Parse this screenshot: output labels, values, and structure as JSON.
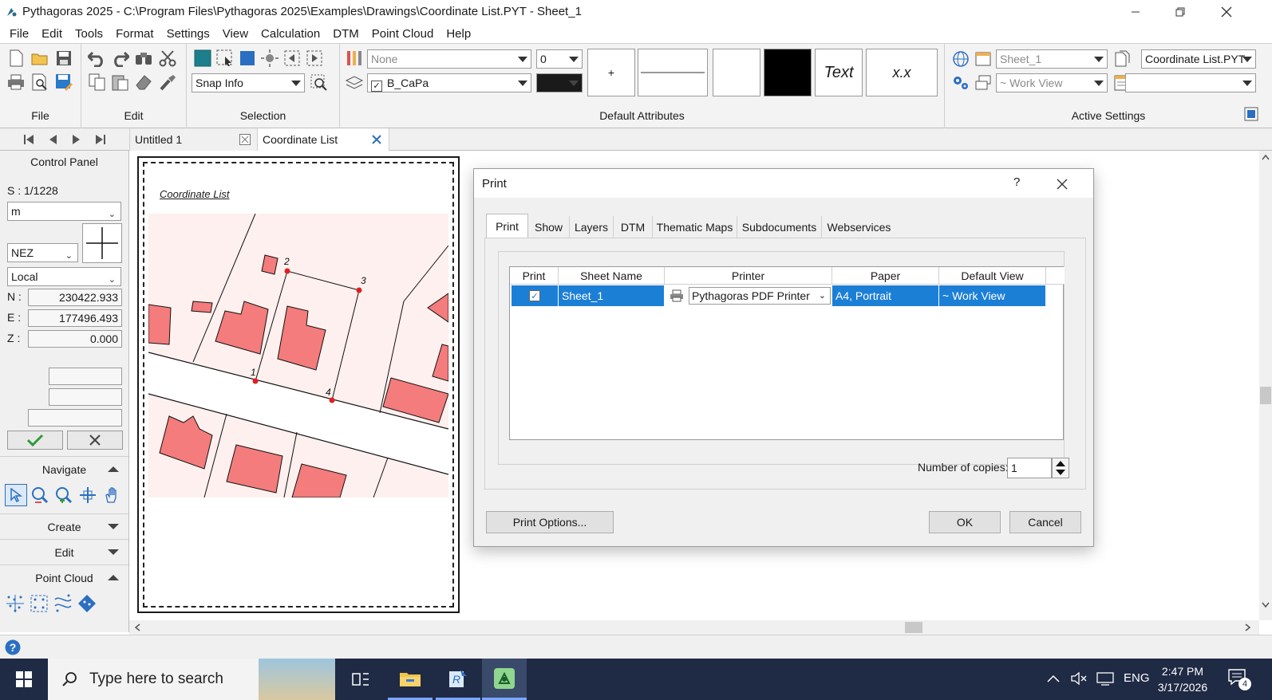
{
  "window": {
    "title": "Pythagoras 2025 - C:\\Program Files\\Pythagoras 2025\\Examples\\Drawings\\Coordinate List.PYT - Sheet_1",
    "minimize_icon": "minimize-icon",
    "restore_icon": "restore-icon",
    "close_icon": "close-icon"
  },
  "menu": [
    "File",
    "Edit",
    "Tools",
    "Format",
    "Settings",
    "View",
    "Calculation",
    "DTM",
    "Point Cloud",
    "Help"
  ],
  "ribbon": {
    "groups": {
      "file": "File",
      "edit": "Edit",
      "selection": "Selection",
      "default_attributes": "Default Attributes",
      "active_settings": "Active Settings"
    },
    "snap_info": "Snap Info",
    "linestyle_value": "None",
    "lineweight_value": "0",
    "layer_value": "B_CaPa",
    "symbol_preview": "+",
    "text_preview": "Text",
    "number_preview": "x.x",
    "sheet_value": "Sheet_1",
    "view_value": "~ Work View",
    "document_value": "Coordinate List.PYT",
    "document2_value": ""
  },
  "tabs": {
    "untitled": "Untitled 1",
    "coordinate_list": "Coordinate List"
  },
  "control_panel": {
    "title": "Control Panel",
    "scale": "S : 1/1228",
    "unit": "m",
    "coord_order": "NEZ",
    "system": "Local",
    "n_label": "N :",
    "n_value": "230422.933",
    "e_label": "E :",
    "e_value": "177496.493",
    "z_label": "Z :",
    "z_value": "0.000",
    "sections": {
      "navigate": "Navigate",
      "create": "Create",
      "edit": "Edit",
      "point_cloud": "Point Cloud"
    }
  },
  "sheet": {
    "title": "Coordinate List",
    "points": [
      "1",
      "2",
      "3",
      "4"
    ]
  },
  "dialog": {
    "title": "Print",
    "help": "?",
    "tabs": [
      "Print",
      "Show",
      "Layers",
      "DTM",
      "Thematic Maps",
      "Subdocuments",
      "Webservices"
    ],
    "columns": [
      "Print",
      "Sheet Name",
      "Printer",
      "Paper",
      "Default View"
    ],
    "rows": [
      {
        "print": true,
        "sheet_name": "Sheet_1",
        "printer": "Pythagoras PDF Printer",
        "paper": "A4, Portrait",
        "default_view": "~ Work View"
      }
    ],
    "copies_label": "Number of copies:",
    "copies_value": "1",
    "print_options": "Print Options...",
    "ok": "OK",
    "cancel": "Cancel"
  },
  "taskbar": {
    "search_placeholder": "Type here to search",
    "language": "ENG",
    "time": "2:47 PM",
    "date": "3/17/2026",
    "notification_count": "4"
  },
  "colors": {
    "accent": "#1c7fd6",
    "parcel_fill": "#f47c7c",
    "map_bg": "#fdf0ee",
    "taskbar": "#1f2a44"
  }
}
